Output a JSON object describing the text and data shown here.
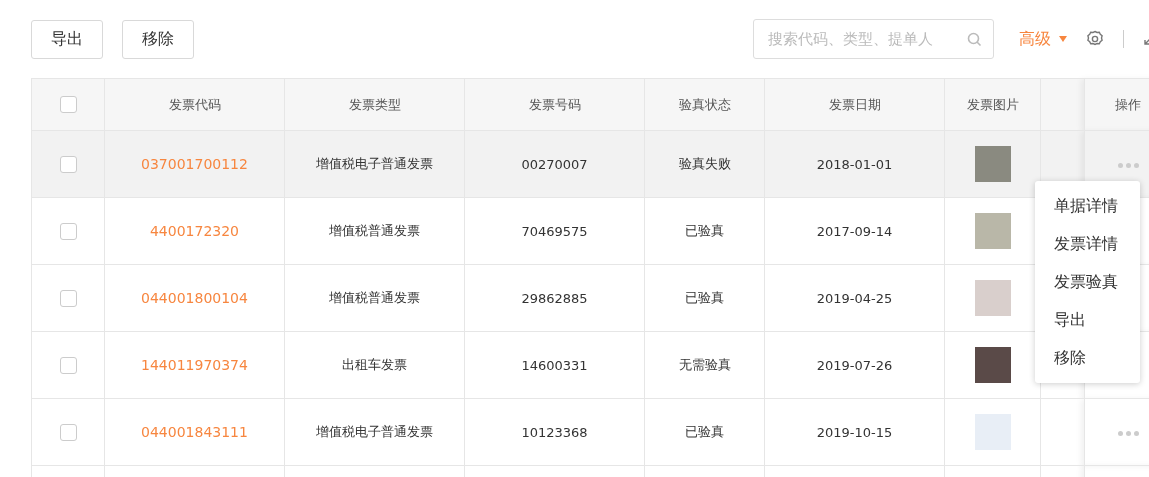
{
  "toolbar": {
    "buttons": [
      "导出",
      "移除"
    ],
    "search": {
      "placeholder": "搜索代码、类型、提单人"
    },
    "advanced": "高级"
  },
  "table": {
    "columns": [
      "发票代码",
      "发票类型",
      "发票号码",
      "验真状态",
      "发票日期",
      "发票图片",
      "操作"
    ],
    "header_checked": false,
    "rows": [
      {
        "code": "037001700112",
        "type": "增值税电子普通发票",
        "number": "00270007",
        "status": "验真失败",
        "date": "2018-01-01",
        "checked": false,
        "hovered": true
      },
      {
        "code": "4400172320",
        "type": "增值税普通发票",
        "number": "70469575",
        "status": "已验真",
        "date": "2017-09-14",
        "checked": false,
        "hovered": false
      },
      {
        "code": "044001800104",
        "type": "增值税普通发票",
        "number": "29862885",
        "status": "已验真",
        "date": "2019-04-25",
        "checked": false,
        "hovered": false
      },
      {
        "code": "144011970374",
        "type": "出租车发票",
        "number": "14600331",
        "status": "无需验真",
        "date": "2019-07-26",
        "checked": false,
        "hovered": false
      },
      {
        "code": "044001843111",
        "type": "增值税电子普通发票",
        "number": "10123368",
        "status": "已验真",
        "date": "2019-10-15",
        "checked": false,
        "hovered": false
      }
    ]
  },
  "action_menu": {
    "items": [
      "单据详情",
      "发票详情",
      "发票验真",
      "导出",
      "移除"
    ]
  }
}
